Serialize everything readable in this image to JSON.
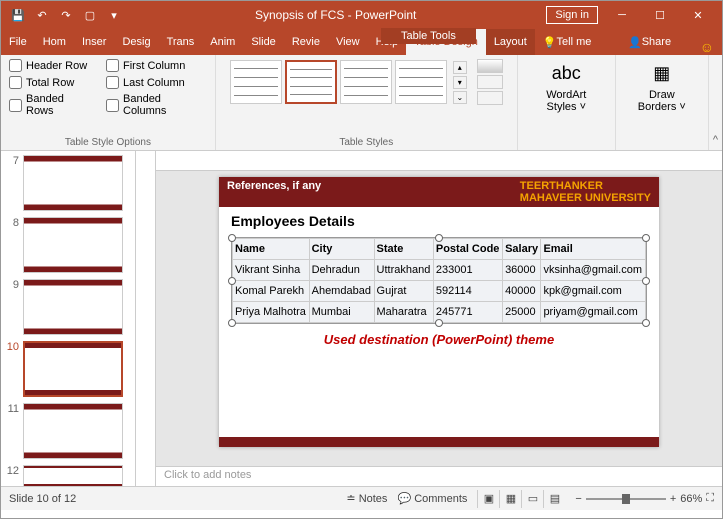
{
  "title": "Synopsis of FCS  -  PowerPoint",
  "contextTab": "Table Tools",
  "signin": "Sign in",
  "tabs": [
    "File",
    "Home",
    "Insert",
    "Design",
    "Transitions",
    "Animations",
    "Slide Show",
    "Review",
    "View",
    "Help",
    "Table Design",
    "Layout"
  ],
  "tabsShort": [
    "File",
    "Hom",
    "Inser",
    "Desig",
    "Trans",
    "Anim",
    "Slide",
    "Revie",
    "View",
    "Help",
    "Table Design",
    "Layout"
  ],
  "tellMe": "Tell me",
  "share": "Share",
  "ribbon": {
    "styleOptions": {
      "label": "Table Style Options",
      "checks": [
        [
          "Header Row",
          "Total Row",
          "Banded Rows"
        ],
        [
          "First Column",
          "Last Column",
          "Banded Columns"
        ]
      ]
    },
    "tableStyles": "Table Styles",
    "wordart": "WordArt Styles",
    "drawBorders": "Draw Borders"
  },
  "thumbs": [
    7,
    8,
    9,
    10,
    11,
    12
  ],
  "activeThumb": 10,
  "slide": {
    "ref": "References, if any",
    "uni1": "TEERTHANKER",
    "uni2": "MAHAVEER UNIVERSITY",
    "heading": "Employees Details",
    "caption": "Used destination (PowerPoint) theme"
  },
  "chart_data": {
    "type": "table",
    "columns": [
      "Name",
      "City",
      "State",
      "Postal Code",
      "Salary",
      "Email"
    ],
    "rows": [
      [
        "Vikrant Sinha",
        "Dehradun",
        "Uttrakhand",
        "233001",
        "36000",
        "vksinha@gmail.com"
      ],
      [
        "Komal Parekh",
        "Ahemdabad",
        "Gujrat",
        "592114",
        "40000",
        "kpk@gmail.com"
      ],
      [
        "Priya Malhotra",
        "Mumbai",
        "Maharatra",
        "245771",
        "25000",
        "priyam@gmail.com"
      ]
    ]
  },
  "notesPlaceholder": "Click to add notes",
  "status": {
    "slide": "Slide 10 of 12",
    "notes": "Notes",
    "comments": "Comments",
    "zoom": "66%"
  }
}
